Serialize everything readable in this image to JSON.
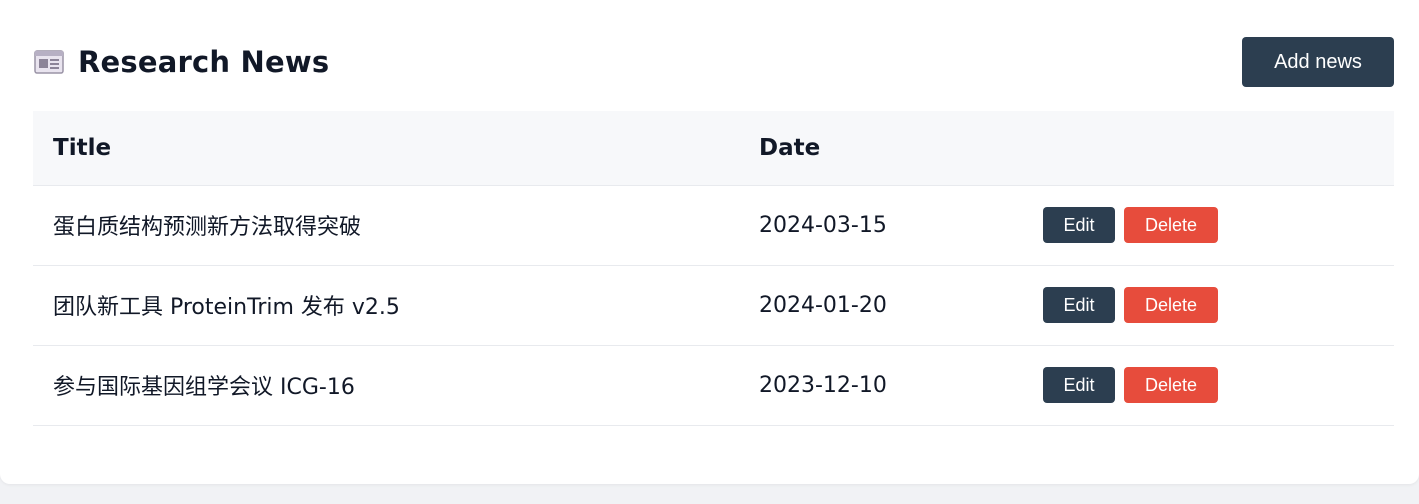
{
  "header": {
    "icon": "newspaper-icon",
    "title": "Research News",
    "add_label": "Add news"
  },
  "table": {
    "columns": [
      "Title",
      "Date",
      ""
    ],
    "rows": [
      {
        "title": "蛋白质结构预测新方法取得突破",
        "date": "2024-03-15",
        "edit_label": "Edit",
        "delete_label": "Delete"
      },
      {
        "title": "团队新工具 ProteinTrim 发布 v2.5",
        "date": "2024-01-20",
        "edit_label": "Edit",
        "delete_label": "Delete"
      },
      {
        "title": "参与国际基因组学会议 ICG-16",
        "date": "2023-12-10",
        "edit_label": "Edit",
        "delete_label": "Delete"
      }
    ]
  },
  "colors": {
    "primary": "#2c3e50",
    "danger": "#e74c3c",
    "header_bg": "#f7f8fa"
  }
}
